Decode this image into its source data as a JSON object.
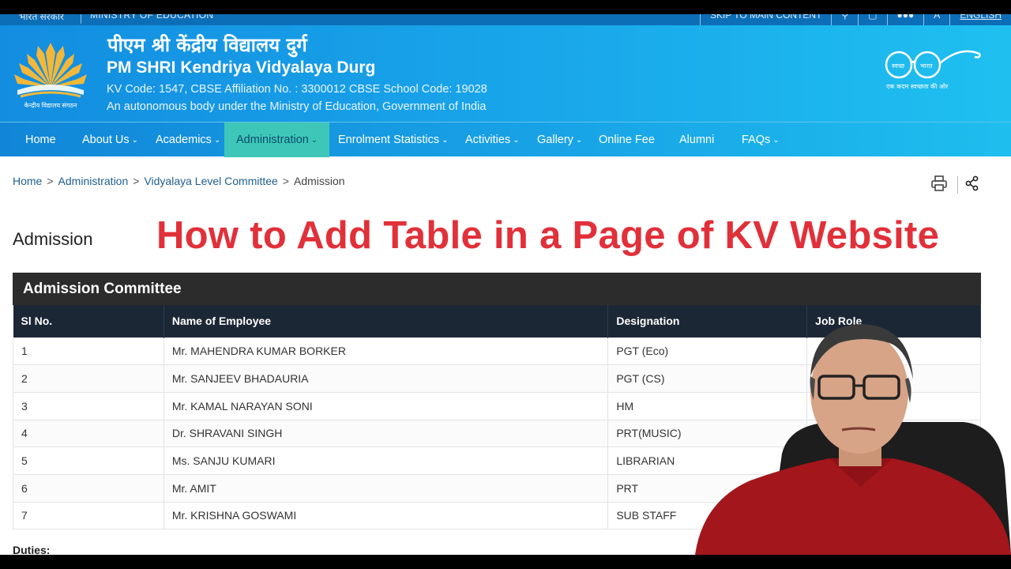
{
  "top_bar": {
    "left_text": "भारत सरकार",
    "ministry": "MINISTRY OF EDUCATION",
    "skip": "SKIP TO MAIN CONTENT",
    "language": "ENGLISH"
  },
  "header": {
    "title_hindi": "पीएम श्री केंद्रीय विद्यालय दुर्ग",
    "title_english": "PM SHRI Kendriya Vidyalaya Durg",
    "codes": "KV Code: 1547, CBSE Affiliation No. : 3300012 CBSE School Code: 19028",
    "tagline": "An autonomous body under the Ministry of Education, Government of India",
    "logo_caption": "केन्द्रीय विद्यालय संगठन",
    "swachh_words": [
      "स्वच्छ",
      "भारत"
    ],
    "swachh_caption": "एक कदम स्वच्छता की ओर"
  },
  "nav": {
    "items": [
      {
        "label": "Home",
        "dropdown": false
      },
      {
        "label": "About Us",
        "dropdown": true
      },
      {
        "label": "Academics",
        "dropdown": true
      },
      {
        "label": "Administration",
        "dropdown": true,
        "active": true
      },
      {
        "label": "Enrolment Statistics",
        "dropdown": true
      },
      {
        "label": "Activities",
        "dropdown": true
      },
      {
        "label": "Gallery",
        "dropdown": true
      },
      {
        "label": "Online Fee",
        "dropdown": false
      },
      {
        "label": "Alumni",
        "dropdown": false
      },
      {
        "label": "FAQs",
        "dropdown": true
      }
    ]
  },
  "breadcrumb": {
    "items": [
      "Home",
      "Administration",
      "Vidyalaya Level Committee"
    ],
    "current": "Admission"
  },
  "page": {
    "title": "Admission",
    "overlay_title": "How to Add Table in a Page of KV Website",
    "duties_label": "Duties:"
  },
  "table": {
    "caption": "Admission Committee",
    "headers": [
      "Sl No.",
      "Name of Employee",
      "Designation",
      "Job Role"
    ],
    "rows": [
      [
        "1",
        "Mr. MAHENDRA KUMAR BORKER",
        "PGT (Eco)",
        ""
      ],
      [
        "2",
        "Mr. SANJEEV BHADAURIA",
        "PGT (CS)",
        ""
      ],
      [
        "3",
        "Mr. KAMAL NARAYAN SONI",
        "HM",
        ""
      ],
      [
        "4",
        "Dr. SHRAVANI SINGH",
        "PRT(MUSIC)",
        ""
      ],
      [
        "5",
        "Ms. SANJU KUMARI",
        "LIBRARIAN",
        ""
      ],
      [
        "6",
        "Mr. AMIT",
        "PRT",
        ""
      ],
      [
        "7",
        "Mr. KRISHNA GOSWAMI",
        "SUB STAFF",
        ""
      ]
    ]
  },
  "colors": {
    "header_blue": "#138de0",
    "nav_active": "#3ec7b8",
    "overlay_red": "#e13039",
    "table_head": "#1c2736",
    "caption_bg": "#2c2c2c"
  }
}
